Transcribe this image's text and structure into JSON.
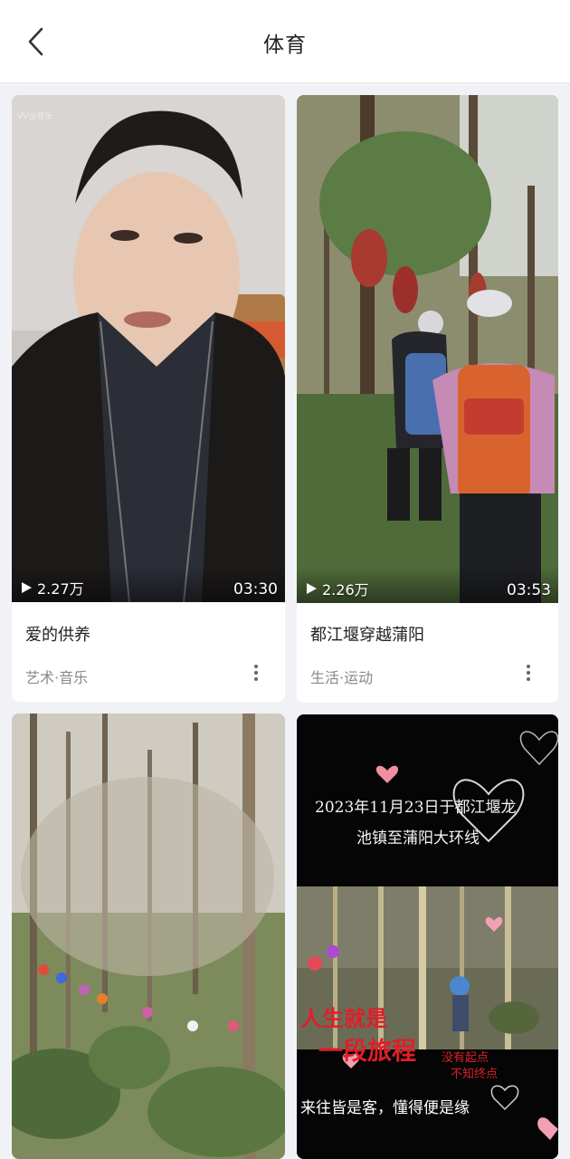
{
  "header": {
    "title": "体育",
    "back_icon": "chevron-left-icon"
  },
  "videos": [
    {
      "title": "爱的供养",
      "category": "艺术·音乐",
      "play_count": "2.27万",
      "duration": "03:30"
    },
    {
      "title": "都江堰穿越蒲阳",
      "category": "生活·运动",
      "play_count": "2.26万",
      "duration": "03:53"
    },
    {
      "title": "",
      "category": "",
      "play_count": "",
      "duration": ""
    },
    {
      "title": "",
      "category": "",
      "play_count": "",
      "duration": "",
      "overlay": {
        "line1": "2023年11月23日于都江堰龙",
        "line2": "池镇至蒲阳大环线",
        "phrase_a": "人生就是",
        "phrase_b": "一段旅程",
        "phrase_c": "没有起点",
        "phrase_d": "不知终点",
        "phrase_e": "来往皆是客，懂得便是缘"
      }
    }
  ]
}
